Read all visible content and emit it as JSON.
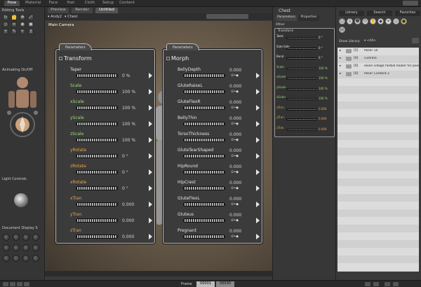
{
  "menu": {
    "tabs": [
      "Pose",
      "Material",
      "Face",
      "Hair",
      "Cloth",
      "Setup",
      "Content"
    ],
    "active": "Pose"
  },
  "editing_tools": {
    "label": "Editing Tools"
  },
  "animating": {
    "label": "Animating On/Off"
  },
  "light_controls": {
    "label": "Light Controls"
  },
  "document_display": {
    "label": "Document Display S"
  },
  "document": {
    "tabs": [
      "Preview",
      "Render",
      "Untitled"
    ],
    "camera_select": "Andy2",
    "actor_select": "Chest",
    "camera_label": "Main Camera"
  },
  "transform_panel": {
    "tab": "Parameters",
    "title": "Transform",
    "params": [
      {
        "name": "Taper",
        "value": "0 %",
        "color": "white"
      },
      {
        "name": "Scale",
        "value": "100 %",
        "color": "green"
      },
      {
        "name": "xScale",
        "value": "100 %",
        "color": "green"
      },
      {
        "name": "yScale",
        "value": "100 %",
        "color": "green"
      },
      {
        "name": "zScale",
        "value": "100 %",
        "color": "green"
      },
      {
        "name": "yRotate",
        "value": "0 °",
        "color": "orange"
      },
      {
        "name": "zRotate",
        "value": "0 °",
        "color": "orange"
      },
      {
        "name": "xRotate",
        "value": "0 °",
        "color": "orange"
      },
      {
        "name": "xTran",
        "value": "0.000",
        "color": "orange"
      },
      {
        "name": "yTran",
        "value": "0.000",
        "color": "orange"
      },
      {
        "name": "zTran",
        "value": "0.000",
        "color": "orange"
      }
    ]
  },
  "morph_panel": {
    "tab": "Parameters",
    "title": "Morph",
    "params": [
      {
        "name": "BellyDepth",
        "value": "0.000"
      },
      {
        "name": "GluteRaiseL",
        "value": "0.000"
      },
      {
        "name": "GluteFlexR",
        "value": "0.000"
      },
      {
        "name": "BellyThin",
        "value": "0.000"
      },
      {
        "name": "TorsoThickness",
        "value": "0.000"
      },
      {
        "name": "GluteTearShaped",
        "value": "0.000"
      },
      {
        "name": "HipRound",
        "value": "0.000"
      },
      {
        "name": "HipCrest",
        "value": "0.000"
      },
      {
        "name": "GluteFlexL",
        "value": "0.000"
      },
      {
        "name": "Gluteus",
        "value": "0.000"
      },
      {
        "name": "Pregnant",
        "value": "0.000"
      }
    ]
  },
  "chest_panel": {
    "title": "Chest",
    "tabs": [
      "Parameters",
      "Properties"
    ],
    "group_other": "Other",
    "group_transform": "Transform",
    "params": [
      {
        "name": "Twist",
        "value": "0 °"
      },
      {
        "name": "Side-Side",
        "value": "0 °"
      },
      {
        "name": "Bend",
        "value": "0 °"
      },
      {
        "name": "Scale",
        "value": "100 %"
      },
      {
        "name": "xScale",
        "value": "100 %"
      },
      {
        "name": "yScale",
        "value": "100 %"
      },
      {
        "name": "zScale",
        "value": "100 %"
      },
      {
        "name": "xTran",
        "value": "0.000"
      },
      {
        "name": "yTran",
        "value": "0.000"
      },
      {
        "name": "zTran",
        "value": "0.000"
      }
    ]
  },
  "library": {
    "tabs": [
      "Library",
      "Search",
      "Favorites"
    ],
    "show_label": "Show Library:",
    "show_value": "<All>",
    "items": [
      {
        "count": "[5]",
        "name": "Poser 10"
      },
      {
        "count": "[0]",
        "name": "runtime"
      },
      {
        "count": "[0]",
        "name": "elven village herbal healer for pose"
      },
      {
        "count": "[0]",
        "name": "Poser Content 2"
      }
    ]
  },
  "bottom": {
    "frame_label": "Frame",
    "frame_current": "00001",
    "frame_total": "00030"
  }
}
